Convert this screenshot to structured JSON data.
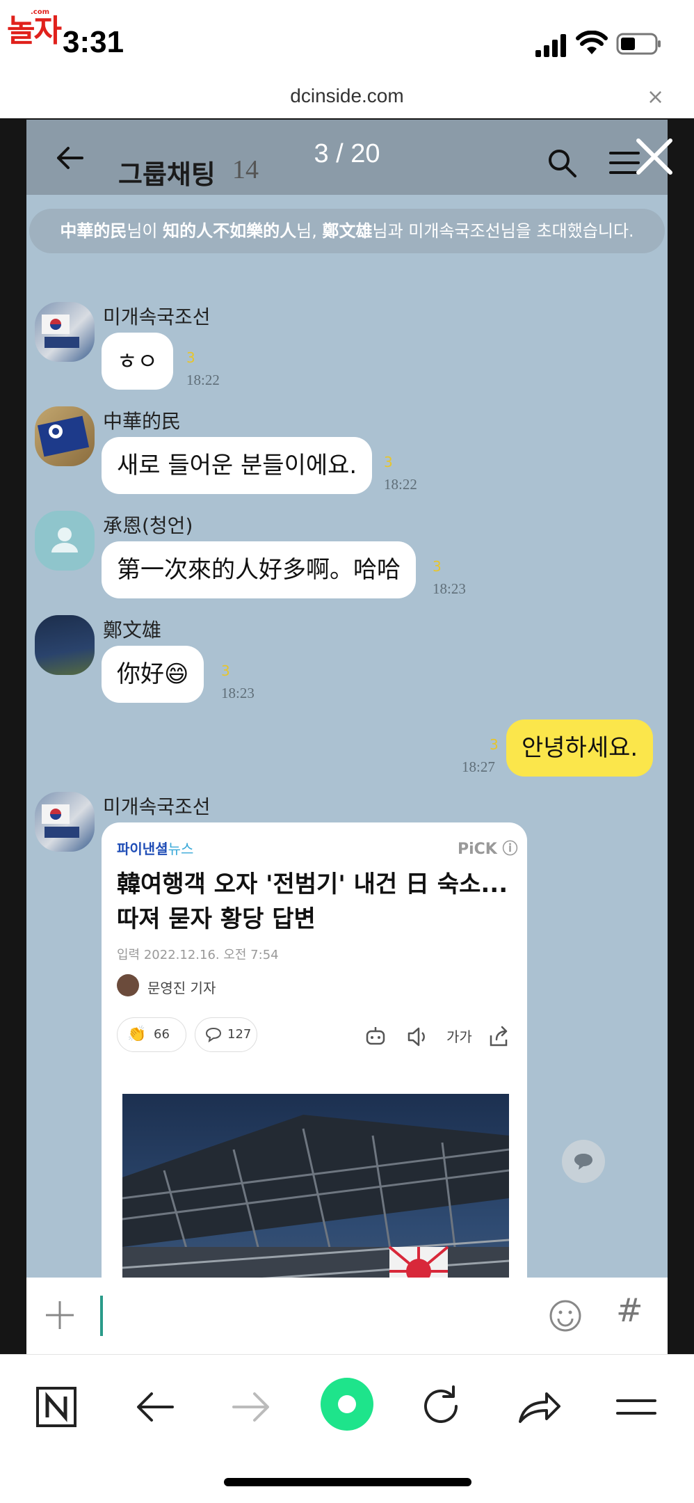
{
  "watermark": {
    "text": "놀자",
    "tiny": ".com"
  },
  "status_bar": {
    "time": "3:31"
  },
  "browser": {
    "url": "dcinside.com",
    "close_label": "×"
  },
  "viewer": {
    "counter": "3 / 20"
  },
  "chat": {
    "title": "그룹채팅",
    "member_count": "14",
    "notice": {
      "part1": "中華的民",
      "part2": "님이 ",
      "part3": "知的人不如樂的人",
      "part4": "님, ",
      "part5": "鄭文雄",
      "part6": "님과 미개속국조선님을 초대했습니다."
    },
    "messages": [
      {
        "sender": "미개속국조선",
        "text": "ㅎㅇ",
        "unread": "3",
        "time": "18:22"
      },
      {
        "sender": "中華的民",
        "text": "새로 들어운 분들이에요.",
        "unread": "3",
        "time": "18:22"
      },
      {
        "sender": "承恩(청언)",
        "text": "第一次來的人好多啊。哈哈",
        "unread": "3",
        "time": "18:23"
      },
      {
        "sender": "鄭文雄",
        "text": "你好😄",
        "unread": "3",
        "time": "18:23"
      },
      {
        "sender": "",
        "text": "안녕하세요.",
        "unread": "3",
        "time": "18:27"
      },
      {
        "sender": "미개속국조선",
        "text": "",
        "unread": "",
        "time": ""
      }
    ],
    "news": {
      "brand": "파이낸셜",
      "brand_sub": "뉴스",
      "pick": "PiCK ⓘ",
      "title": "韓여행객 오자 '전범기' 내건 日 숙소...따져 묻자 황당 답변",
      "date": "입력 2022.12.16. 오전 7:54",
      "reporter": "문영진 기자",
      "reaction_count": "66",
      "comment_count": "127",
      "font_label": "가가"
    },
    "input": {
      "hash": "#"
    }
  },
  "colors": {
    "chat_bg": "#abc1d1",
    "my_bubble": "#fbe64b",
    "accent_green": "#1ee48b"
  }
}
